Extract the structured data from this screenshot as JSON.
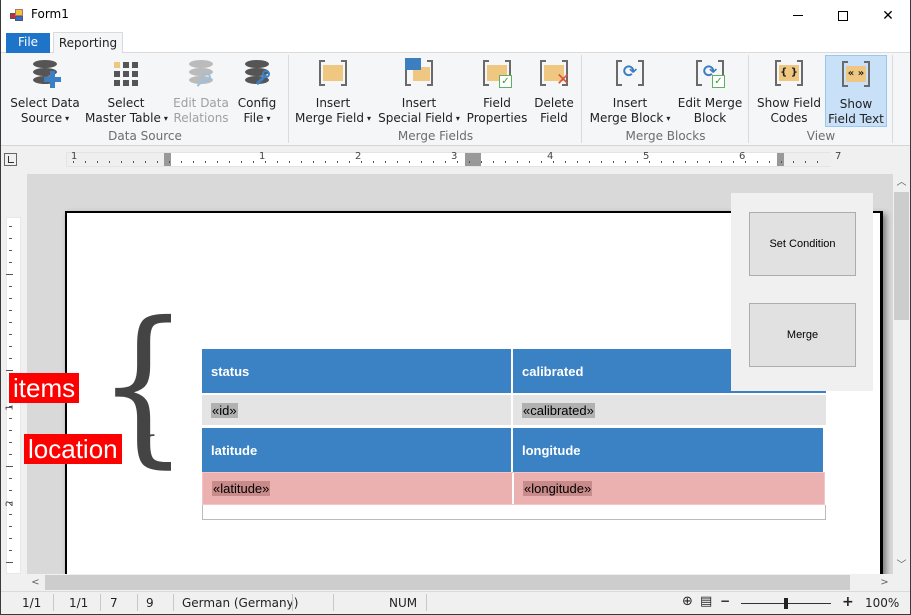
{
  "window": {
    "title": "Form1",
    "controls": {
      "minimize": "minimize",
      "maximize": "maximize",
      "close": "close"
    }
  },
  "ribbon": {
    "tabs": [
      {
        "label": "File",
        "active": false
      },
      {
        "label": "Reporting",
        "active": true
      }
    ],
    "groups": [
      {
        "label": "Data Source",
        "buttons": [
          {
            "line1": "Select Data",
            "line2": "Source",
            "dropdown": true,
            "icon": "database-add-icon",
            "enabled": true
          },
          {
            "line1": "Select",
            "line2": "Master Table",
            "dropdown": true,
            "icon": "table-grid-icon",
            "enabled": true
          },
          {
            "line1": "Edit Data",
            "line2": "Relations",
            "dropdown": false,
            "icon": "database-key-icon",
            "enabled": false
          },
          {
            "line1": "Config",
            "line2": "File",
            "dropdown": true,
            "icon": "database-wrench-icon",
            "enabled": true
          }
        ]
      },
      {
        "label": "Merge Fields",
        "buttons": [
          {
            "line1": "Insert",
            "line2": "Merge Field",
            "dropdown": true,
            "icon": "merge-field-icon"
          },
          {
            "line1": "Insert",
            "line2": "Special Field",
            "dropdown": true,
            "icon": "special-field-icon"
          },
          {
            "line1": "Field",
            "line2": "Properties",
            "dropdown": false,
            "icon": "field-properties-icon"
          },
          {
            "line1": "Delete",
            "line2": "Field",
            "dropdown": false,
            "icon": "delete-field-icon"
          }
        ]
      },
      {
        "label": "Merge Blocks",
        "buttons": [
          {
            "line1": "Insert",
            "line2": "Merge Block",
            "dropdown": true,
            "icon": "merge-block-icon"
          },
          {
            "line1": "Edit Merge",
            "line2": "Block",
            "dropdown": false,
            "icon": "edit-merge-block-icon"
          }
        ]
      },
      {
        "label": "View",
        "buttons": [
          {
            "line1": "Show Field",
            "line2": "Codes",
            "dropdown": false,
            "icon": "field-codes-icon",
            "glyph": "{ }",
            "active": false
          },
          {
            "line1": "Show",
            "line2": "Field Text",
            "dropdown": false,
            "icon": "field-text-icon",
            "glyph": "« »",
            "active": true
          }
        ]
      }
    ],
    "dropdown_glyph": "▾"
  },
  "ruler": {
    "horizontal_numbers": [
      "1",
      "1",
      "2",
      "3",
      "4",
      "5",
      "6",
      "7"
    ],
    "vertical_numbers": [
      "1",
      "2"
    ]
  },
  "document": {
    "table": {
      "rows": [
        {
          "type": "header",
          "cells": [
            "status",
            "calibrated"
          ]
        },
        {
          "type": "data",
          "block": "items",
          "cells": [
            "«id»",
            "«calibrated»"
          ]
        },
        {
          "type": "header",
          "cells": [
            "latitude",
            "longitude"
          ]
        },
        {
          "type": "data",
          "block": "location",
          "cells": [
            "«latitude»",
            "«longitude»"
          ]
        },
        {
          "type": "empty",
          "cells": [
            ""
          ]
        }
      ]
    },
    "annotations": [
      {
        "label": "items",
        "brace": "{"
      },
      {
        "label": "location",
        "brace": "{"
      }
    ]
  },
  "float_panel": {
    "buttons": [
      {
        "label": "Set Condition"
      },
      {
        "label": "Merge"
      }
    ]
  },
  "scrollbars": {
    "up": "▲",
    "down": "▼",
    "left": "<",
    "right": ">"
  },
  "statusbar": {
    "section": "1/1",
    "page": "1/1",
    "line": "7",
    "column": "9",
    "language": "German (Germany)",
    "num_lock": "NUM",
    "zoom_minus": "−",
    "zoom_plus": "+",
    "zoom_level": "100%",
    "zoom_fraction": 0.5
  },
  "colors": {
    "accent": "#1e74c8",
    "table_header": "#3b82c4",
    "merge_block_highlight": "#ebb0b0",
    "annotation": "#ff0000"
  }
}
